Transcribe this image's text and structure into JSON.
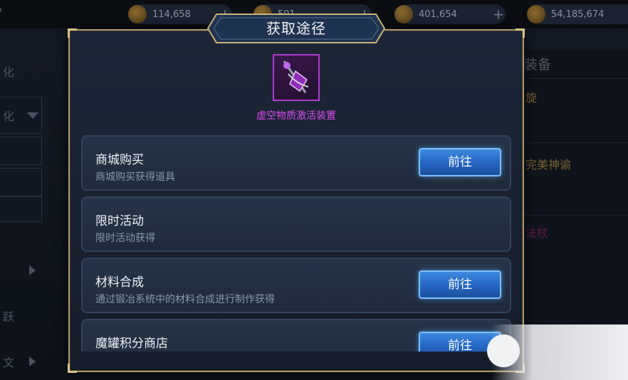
{
  "top_bar": {
    "resources": [
      {
        "icon": "scroll-icon",
        "value": "114,658"
      },
      {
        "icon": "scroll-icon",
        "value": "591"
      },
      {
        "icon": "coin-icon",
        "value": "401,654"
      },
      {
        "icon": "gold-coin-icon",
        "value": "54,185,674"
      }
    ],
    "help_label": "?"
  },
  "left_tabs": [
    "化",
    "化",
    "",
    "",
    "",
    "",
    "跃",
    "文"
  ],
  "right_panel": {
    "title": "装备",
    "items": [
      {
        "label": "旋",
        "color": "#c9a24a"
      },
      {
        "label": "完美神谕",
        "color": "#c9a24a"
      },
      {
        "label": "法杖",
        "color": "#b0208a"
      }
    ]
  },
  "modal": {
    "title": "获取途径",
    "item": {
      "name": "虚空物质激活装置",
      "rarity_color": "#d94bf0"
    },
    "sources": [
      {
        "title": "商城购买",
        "subtitle": "商城购买获得道具",
        "button": "前往",
        "has_button": true
      },
      {
        "title": "限时活动",
        "subtitle": "限时活动获得",
        "button": "",
        "has_button": false
      },
      {
        "title": "材料合成",
        "subtitle": "通过锻冶系统中的材料合成进行制作获得",
        "button": "前往",
        "has_button": true
      },
      {
        "title": "魔罐积分商店",
        "subtitle": "",
        "button": "前往",
        "has_button": true
      }
    ]
  },
  "colors": {
    "accent_blue": "#2f78d6",
    "frame_gold": "#b09a6c",
    "epic_purple": "#b23ad0"
  }
}
